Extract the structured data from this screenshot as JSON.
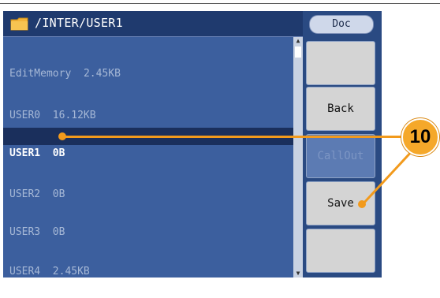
{
  "header": {
    "path": "/INTER/USER1"
  },
  "file_list": [
    {
      "name": "EditMemory",
      "size": "2.45KB"
    },
    {
      "name": "USER0",
      "size": "16.12KB"
    },
    {
      "name": "USER1",
      "size": "0B",
      "selected": true
    },
    {
      "name": "USER2",
      "size": "0B"
    },
    {
      "name": "USER3",
      "size": "0B"
    },
    {
      "name": "USER4",
      "size": "2.45KB"
    }
  ],
  "softkeys": {
    "doc_label": "Doc",
    "key1_label": "",
    "back_label": "Back",
    "callout_label": "CallOut",
    "save_label": "Save",
    "key6_label": ""
  },
  "annotation": {
    "number": "10"
  },
  "colors": {
    "accent": "#f29a1c",
    "panel_bg": "#3c5f9e",
    "selected_bg": "#1a2f5c"
  },
  "icons": {
    "folder": "folder-icon"
  }
}
